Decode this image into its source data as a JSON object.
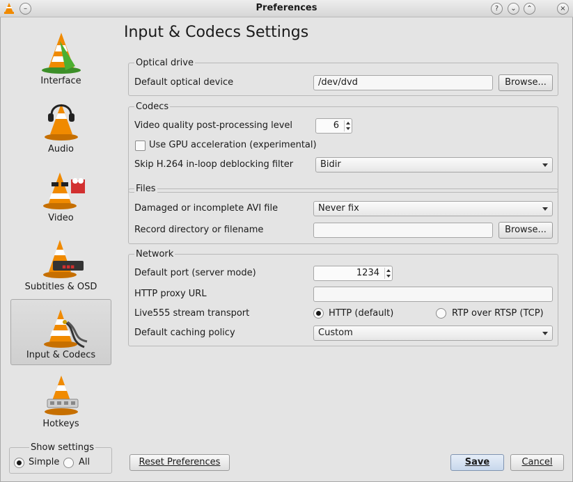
{
  "window": {
    "title": "Preferences",
    "title_buttons": [
      {
        "name": "help-icon",
        "glyph": "?"
      },
      {
        "name": "minimize-icon",
        "glyph": "⌄"
      },
      {
        "name": "maximize-icon",
        "glyph": "⌃"
      },
      {
        "name": "close-icon",
        "glyph": "×"
      }
    ]
  },
  "sidebar": {
    "items": [
      {
        "label": "Interface",
        "icon": "interface-cone-icon"
      },
      {
        "label": "Audio",
        "icon": "audio-cone-icon"
      },
      {
        "label": "Video",
        "icon": "video-cone-icon"
      },
      {
        "label": "Subtitles & OSD",
        "icon": "subtitles-cone-icon"
      },
      {
        "label": "Input & Codecs",
        "icon": "input-codecs-cone-icon",
        "selected": true
      },
      {
        "label": "Hotkeys",
        "icon": "hotkeys-cone-icon"
      }
    ],
    "show_settings": {
      "title": "Show settings",
      "simple": "Simple",
      "all": "All",
      "selected": "Simple"
    }
  },
  "page": {
    "title": "Input & Codecs Settings",
    "optical": {
      "legend": "Optical drive",
      "device_label": "Default optical device",
      "device_value": "/dev/dvd",
      "browse": "Browse..."
    },
    "codecs": {
      "legend": "Codecs",
      "pp_label": "Video quality post-processing level",
      "pp_value": "6",
      "gpu_label": "Use GPU acceleration (experimental)",
      "gpu_checked": false,
      "skip_label": "Skip H.264 in-loop deblocking filter",
      "skip_value": "Bidir"
    },
    "files": {
      "legend": "Files",
      "avi_label": "Damaged or incomplete AVI file",
      "avi_value": "Never fix",
      "record_label": "Record directory or filename",
      "record_value": "",
      "browse": "Browse..."
    },
    "network": {
      "legend": "Network",
      "port_label": "Default port (server mode)",
      "port_value": "1234",
      "proxy_label": "HTTP proxy URL",
      "proxy_value": "",
      "transport_label": "Live555 stream transport",
      "transport_http": "HTTP (default)",
      "transport_rtp": "RTP over RTSP (TCP)",
      "transport_selected": "HTTP (default)",
      "caching_label": "Default caching policy",
      "caching_value": "Custom"
    }
  },
  "footer": {
    "reset": "Reset Preferences",
    "save": "Save",
    "cancel": "Cancel"
  },
  "colors": {
    "cone_orange": "#f08a00",
    "accent_blue": "#c8d8ec"
  }
}
